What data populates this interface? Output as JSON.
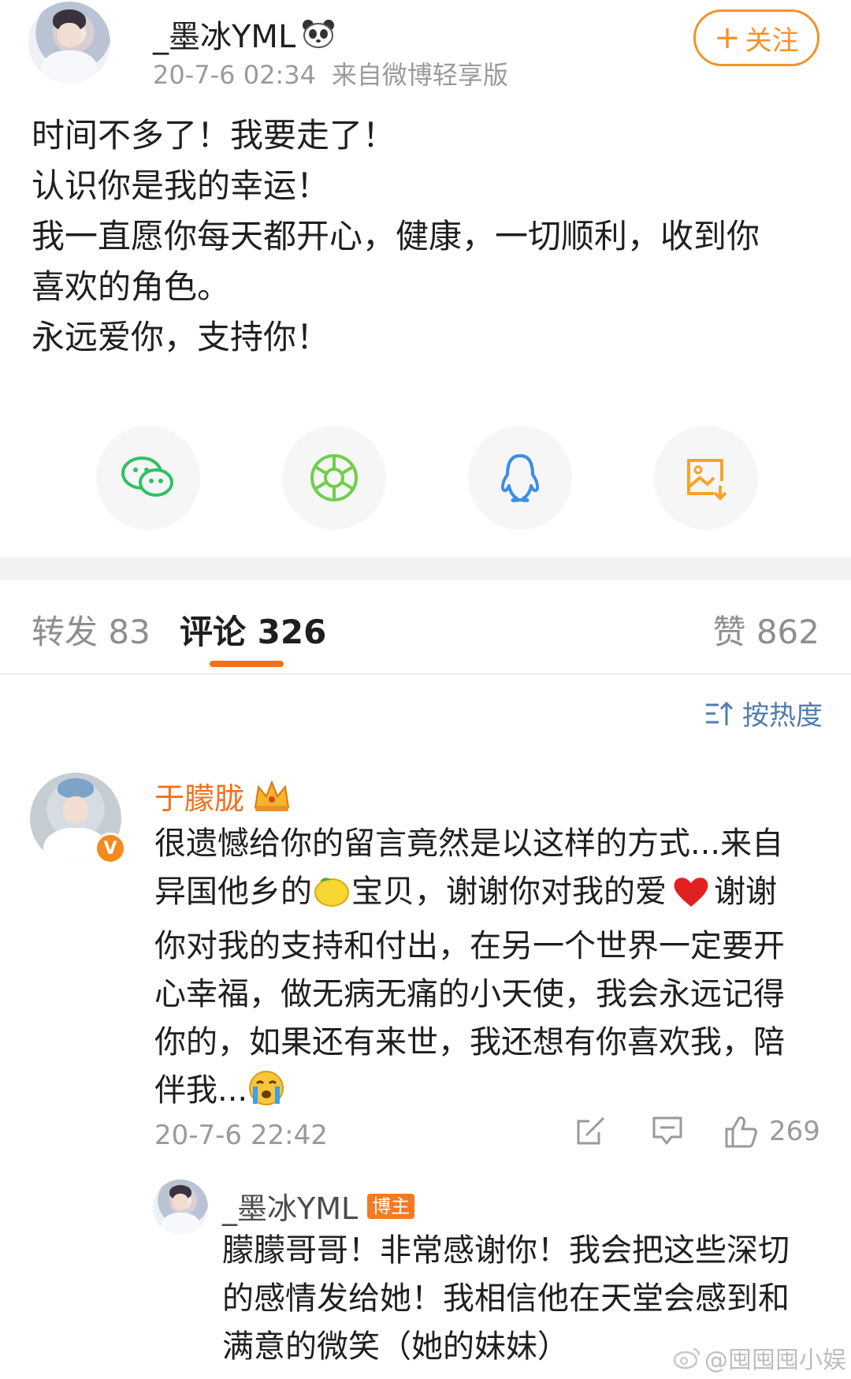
{
  "post": {
    "author": "_墨冰YML",
    "time": "20-7-6 02:34",
    "source": "来自微博轻享版",
    "follow_label": "关注",
    "lines": [
      "时间不多了！我要走了！",
      "认识你是我的幸运！",
      "我一直愿你每天都开心，健康，一切顺利，收到你",
      "喜欢的角色。",
      "永远爱你，支持你！"
    ]
  },
  "share": {
    "icons": [
      "wechat-icon",
      "moments-icon",
      "qq-icon",
      "save-image-icon"
    ],
    "colors": {
      "wechat": "#2fc163",
      "moments": "#6fcf4a",
      "qq": "#3a8ee6",
      "save": "#f4a428"
    }
  },
  "tabs": {
    "repost": "转发 83",
    "comment": "评论 326",
    "like": "赞 862"
  },
  "sort_label": "按热度",
  "comment": {
    "author": "于朦胧",
    "badge": "V",
    "lines": [
      {
        "text": "很遗憾给你的留言竟然是以这样的方式...来自",
        "emoji": "",
        "tail": ""
      },
      {
        "text": "异国他乡的",
        "emoji": "🍋",
        "tail": "宝贝，谢谢你对我的爱"
      },
      {
        "text": "你对我的支持和付出，在另一个世界一定要开",
        "emoji": "",
        "tail": ""
      },
      {
        "text": "心幸福，做无病无痛的小天使，我会永远记得",
        "emoji": "",
        "tail": ""
      },
      {
        "text": "你的，如果还有来世，我还想有你喜欢我，陪",
        "emoji": "",
        "tail": ""
      },
      {
        "text": "伴我...",
        "emoji": "",
        "tail": ""
      }
    ],
    "heart_tail": "谢谢",
    "time": "20-7-6 22:42",
    "likes": "269"
  },
  "reply": {
    "author": "_墨冰YML",
    "tag": "博主",
    "lines": [
      "朦朦哥哥！非常感谢你！我会把这些深切",
      "的感情发给她！我相信他在天堂会感到和",
      "满意的微笑（她的妹妹）"
    ]
  },
  "watermark": "@囤囤囤小娱",
  "accent": "#f2701c"
}
